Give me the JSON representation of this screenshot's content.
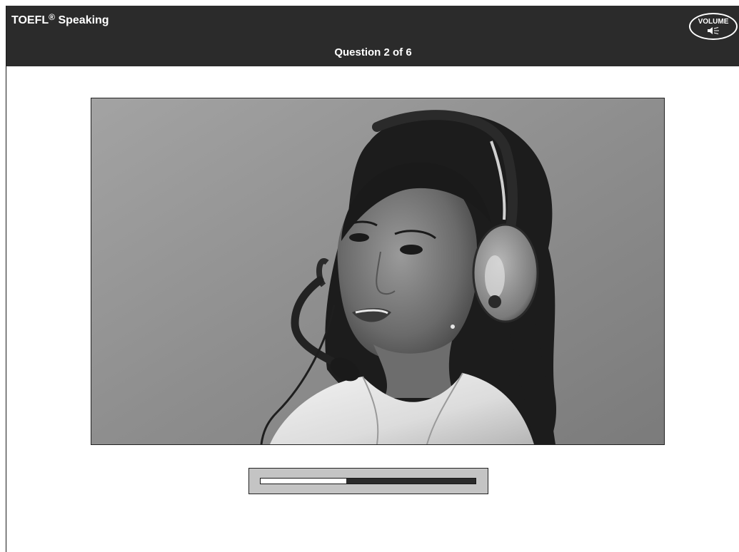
{
  "header": {
    "title": "TOEFL",
    "title_mark": "®",
    "title_suffix": " Speaking",
    "question_counter": "Question 2 of 6",
    "volume_label": "VOLUME",
    "volume_icon": "speaker-icon"
  },
  "media": {
    "type": "photo",
    "content": "woman-with-headset"
  },
  "playback": {
    "progress_fraction": 0.4
  },
  "colors": {
    "header_bg": "#2b2b2b",
    "progress_fill": "#ffffff",
    "progress_track": "#2b2b2b",
    "panel_bg": "#c4c4c4"
  }
}
